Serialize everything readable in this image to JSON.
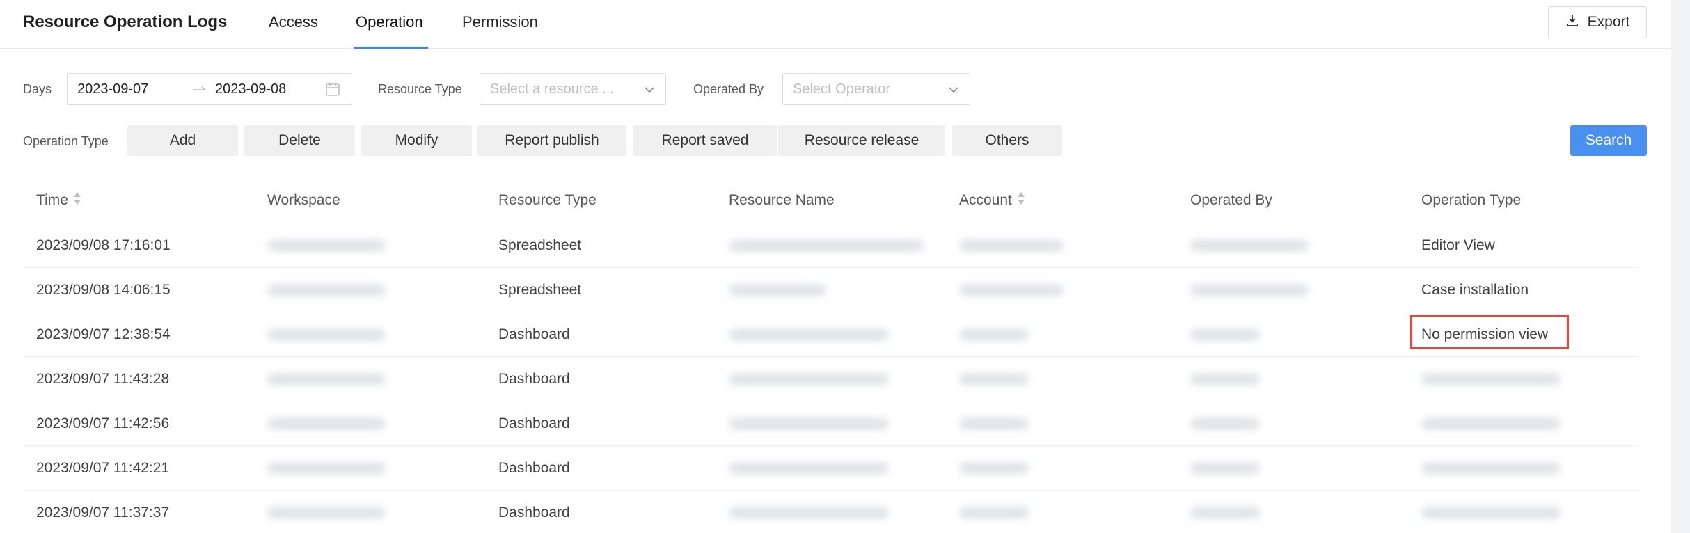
{
  "header": {
    "title": "Resource Operation Logs",
    "tabs": [
      {
        "label": "Access"
      },
      {
        "label": "Operation"
      },
      {
        "label": "Permission"
      }
    ],
    "export_label": "Export"
  },
  "filters": {
    "days_label": "Days",
    "date_start": "2023-09-07",
    "date_end": "2023-09-08",
    "resource_type_label": "Resource Type",
    "resource_type_placeholder": "Select a resource ...",
    "operated_by_label": "Operated By",
    "operated_by_placeholder": "Select Operator",
    "operation_type_label": "Operation Type",
    "operation_types": [
      "Add",
      "Delete",
      "Modify",
      "Report publish",
      "Report saved",
      "Resource release",
      "Others"
    ],
    "search_label": "Search"
  },
  "table": {
    "columns": [
      "Time",
      "Workspace",
      "Resource Type",
      "Resource Name",
      "Account",
      "Operated By",
      "Operation Type"
    ],
    "rows": [
      {
        "time": "2023/09/08 17:16:01",
        "resource_type": "Spreadsheet",
        "operation_type": "Editor View"
      },
      {
        "time": "2023/09/08 14:06:15",
        "resource_type": "Spreadsheet",
        "operation_type": "Case installation"
      },
      {
        "time": "2023/09/07 12:38:54",
        "resource_type": "Dashboard",
        "operation_type": "No permission view"
      },
      {
        "time": "2023/09/07 11:43:28",
        "resource_type": "Dashboard",
        "operation_type": ""
      },
      {
        "time": "2023/09/07 11:42:56",
        "resource_type": "Dashboard",
        "operation_type": ""
      },
      {
        "time": "2023/09/07 11:42:21",
        "resource_type": "Dashboard",
        "operation_type": ""
      },
      {
        "time": "2023/09/07 11:37:37",
        "resource_type": "Dashboard",
        "operation_type": ""
      }
    ]
  },
  "colors": {
    "accent": "#3b82f6",
    "search_button": "#4a90f0",
    "highlight": "#e5483b"
  }
}
